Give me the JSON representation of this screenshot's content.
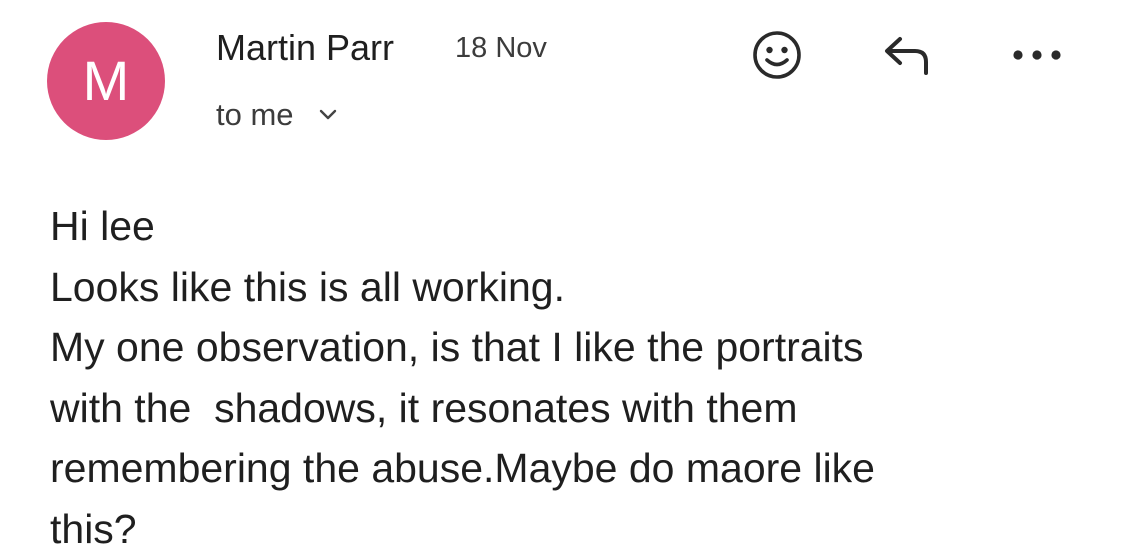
{
  "header": {
    "avatar_letter": "M",
    "avatar_color": "#dc4f7b",
    "sender_name": "Martin Parr",
    "date": "18 Nov",
    "recipient_label": "to me",
    "icons": [
      "emoji-icon",
      "reply-icon",
      "more-icon",
      "chevron-down-icon"
    ]
  },
  "message": {
    "lines": [
      "Hi lee",
      "Looks like this is all working.",
      "My one observation, is that I like the portraits",
      "with the  shadows, it resonates with them",
      "remembering the abuse.Maybe do maore like",
      "this?"
    ]
  }
}
